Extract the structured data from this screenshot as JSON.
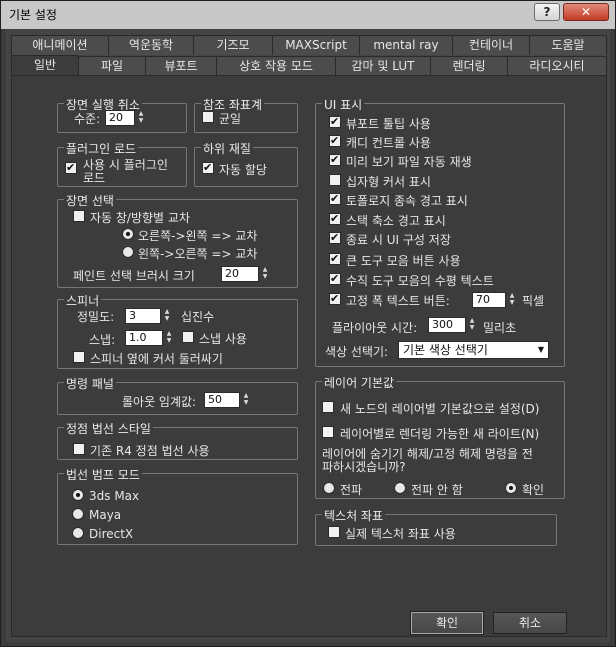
{
  "window": {
    "title": "기본 설정"
  },
  "title_buttons": {
    "help": "?",
    "close": "✕"
  },
  "tabs_row1": [
    "애니메이션",
    "역운동학",
    "기즈모",
    "MAXScript",
    "mental ray",
    "컨테이너",
    "도움말"
  ],
  "tabs_row2": [
    "일반",
    "파일",
    "뷰포트",
    "상호 작용 모드",
    "감마 및 LUT",
    "렌더링",
    "라디오시티"
  ],
  "undo": {
    "legend": "장면 실행 취소",
    "label": "수준:",
    "value": "20"
  },
  "refcoord": {
    "legend": "참조 좌표계",
    "uniform": "균일"
  },
  "plugin": {
    "legend": "플러그인 로드",
    "load_on_use_1": "사용 시 플러그인",
    "load_on_use_2": "로드"
  },
  "submat": {
    "legend": "하위 재질",
    "auto_assign": "자동 할당"
  },
  "scene": {
    "legend": "장면 선택",
    "auto_crossing": "자동 창/방향별 교차",
    "r2l": "오른쪽->왼쪽 => 교차",
    "l2r": "왼쪽->오른쪽 => 교차",
    "brush_label": "페인트 선택 브러시 크기",
    "brush_value": "20"
  },
  "spinner": {
    "legend": "스피너",
    "precision_label": "정밀도:",
    "precision_value": "3",
    "decimal": "십진수",
    "snap_label": "스냅:",
    "snap_value": "1.0",
    "use_snap": "스냅 사용",
    "wrap": "스피너 옆에 커서 둘러싸기"
  },
  "cmd": {
    "legend": "명령 패널",
    "rollout_label": "롤아웃 임계값:",
    "rollout_value": "50"
  },
  "vnorm": {
    "legend": "정점 법선 스타일",
    "r4": "기존 R4 정점 법선 사용"
  },
  "bump": {
    "legend": "법선 범프 모드",
    "opts": [
      "3ds Max",
      "Maya",
      "DirectX"
    ]
  },
  "ui": {
    "legend": "UI 표시",
    "items": [
      "뷰포트 툴팁 사용",
      "캐디 컨트롤 사용",
      "미리 보기 파일 자동 재생",
      "십자형 커서 표시",
      "토폴로지 종속 경고 표시",
      "스택 축소 경고 표시",
      "종료 시 UI 구성 저장",
      "큰 도구 모음 버튼 사용",
      "수직 도구 모음의 수평 텍스트"
    ],
    "fixed_label": "고정 폭 텍스트 버튼:",
    "fixed_value": "70",
    "pixels": "픽셀",
    "flyout_label": "플라이아웃 시간:",
    "flyout_value": "300",
    "ms": "밀리초",
    "color_label": "색상 선택기:",
    "color_value": "기본 색상 선택기"
  },
  "layer": {
    "legend": "레이어 기본값",
    "new_by_layer": "새 노드의 레이어별 기본값으로 설정(D)",
    "render_light": "레이어별로 렌더링 가능한 새 라이트(N)",
    "q1": "레이어에 숨기기 해제/고정 해제 명령을 전",
    "q2": "파하시겠습니까?",
    "opt_all": "전파",
    "opt_none": "전파 안 함",
    "opt_ask": "확인"
  },
  "tex": {
    "legend": "텍스처 좌표",
    "real": "실제 텍스처 좌표 사용"
  },
  "buttons": {
    "ok": "확인",
    "cancel": "취소"
  }
}
